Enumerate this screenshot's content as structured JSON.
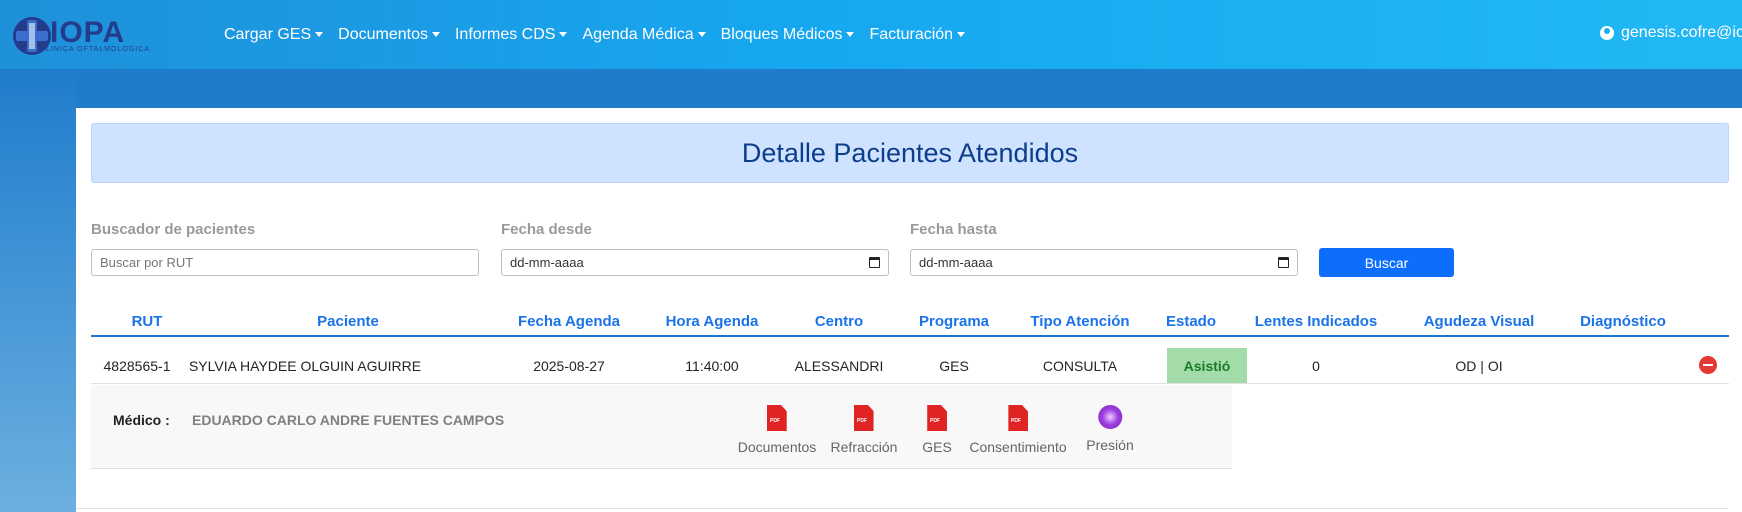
{
  "navbar": {
    "brand": "IOPA",
    "brand_sub": "CLINICA OFTALMOLOGICA",
    "menu": [
      {
        "label": "Cargar GES"
      },
      {
        "label": "Documentos"
      },
      {
        "label": "Informes CDS"
      },
      {
        "label": "Agenda Médica"
      },
      {
        "label": "Bloques Médicos"
      },
      {
        "label": "Facturación"
      }
    ],
    "user": "genesis.cofre@io"
  },
  "page": {
    "title": "Detalle Pacientes Atendidos"
  },
  "filters": {
    "search_label": "Buscador de pacientes",
    "search_placeholder": "Buscar por RUT",
    "from_label": "Fecha desde",
    "from_value": "dd-mm-aaaa",
    "to_label": "Fecha hasta",
    "to_value": "dd-mm-aaaa",
    "button": "Buscar"
  },
  "table": {
    "headers": [
      "RUT",
      "Paciente",
      "Fecha Agenda",
      "Hora Agenda",
      "Centro",
      "Programa",
      "Tipo Atención",
      "Estado",
      "Lentes Indicados",
      "Agudeza Visual",
      "Diagnóstico"
    ],
    "rows": [
      {
        "rut": "4828565-1",
        "paciente": "SYLVIA HAYDEE OLGUIN AGUIRRE",
        "fecha": "2025-08-27",
        "hora": "11:40:00",
        "centro": "ALESSANDRI",
        "programa": "GES",
        "tipo": "CONSULTA",
        "estado": "Asistió",
        "lentes": "0",
        "agudeza": "OD | OI",
        "diagnostico": ""
      }
    ]
  },
  "detail": {
    "medico_label": "Médico :",
    "medico_value": "EDUARDO CARLO ANDRE FUENTES CAMPOS",
    "docs": [
      {
        "label": "Documentos",
        "icon": "pdf-icon"
      },
      {
        "label": "Refracción",
        "icon": "pdf-icon"
      },
      {
        "label": "GES",
        "icon": "pdf-icon"
      },
      {
        "label": "Consentimiento",
        "icon": "pdf-icon"
      },
      {
        "label": "Presión",
        "icon": "pressure-icon"
      }
    ]
  },
  "colors": {
    "navbar": "#16a7ef",
    "header_text": "#1a73e8",
    "title_bg": "#cfe2ff",
    "estado_bg": "#a3dca8",
    "button": "#0d6efd",
    "pdf": "#e02424"
  }
}
